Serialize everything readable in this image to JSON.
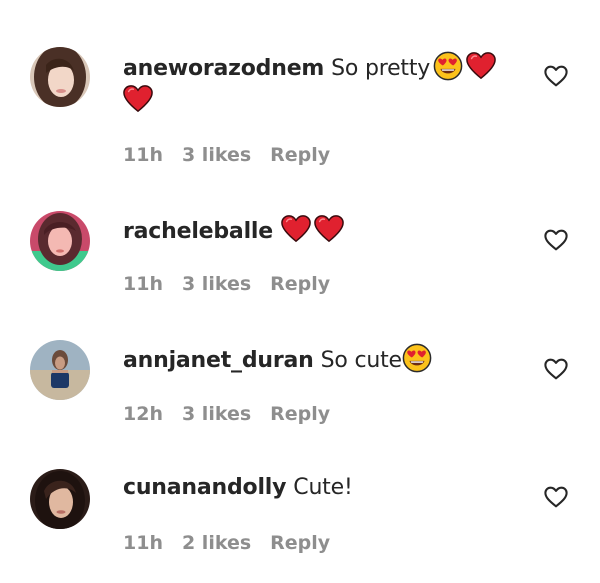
{
  "comments": [
    {
      "username": "aneworazodnem",
      "text": "So pretty",
      "emojis_line1": [
        "heart-eyes-emoji",
        "red-heart-emoji"
      ],
      "emojis_line2": [
        "red-heart-emoji"
      ],
      "time": "11h",
      "likes": "3 likes",
      "reply_label": "Reply"
    },
    {
      "username": "racheleballe",
      "text": "",
      "emojis_line1": [
        "red-heart-emoji",
        "red-heart-emoji"
      ],
      "time": "11h",
      "likes": "3 likes",
      "reply_label": "Reply"
    },
    {
      "username": "annjanet_duran",
      "text": "So cute",
      "emojis_line1": [
        "heart-eyes-emoji"
      ],
      "time": "12h",
      "likes": "3 likes",
      "reply_label": "Reply"
    },
    {
      "username": "cunanandolly",
      "text": "Cute!",
      "emojis_line1": [],
      "time": "11h",
      "likes": "2 likes",
      "reply_label": "Reply"
    }
  ],
  "icons": {
    "like": "heart-outline-icon"
  },
  "colors": {
    "text": "#262626",
    "meta": "#8e8e8e",
    "heart_red": "#e0212f",
    "emoji_yellow": "#fcc21b"
  }
}
